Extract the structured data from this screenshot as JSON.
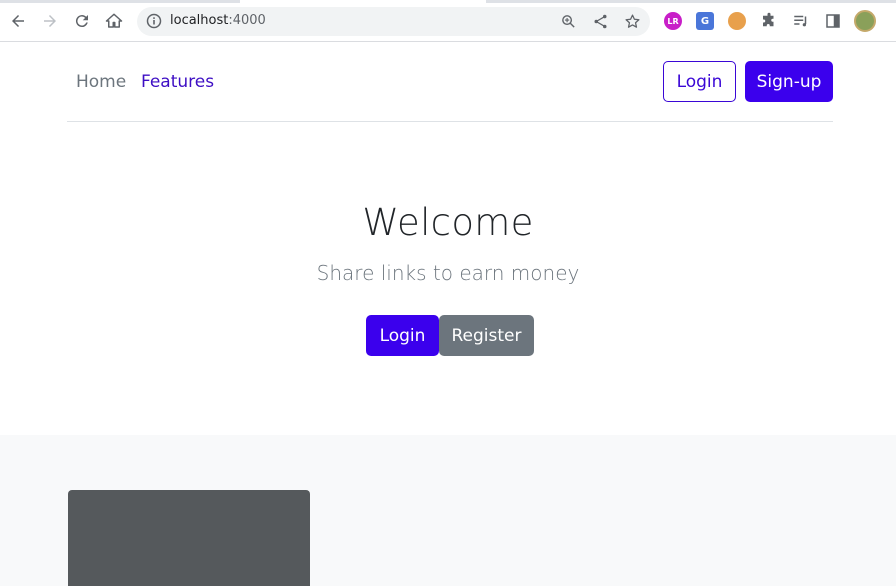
{
  "browser": {
    "url_host": "localhost",
    "url_port": ":4000",
    "icons": [
      "back-icon",
      "forward-icon",
      "reload-icon",
      "home-icon",
      "site-info-icon",
      "zoom-icon",
      "share-icon",
      "bookmark-star-icon",
      "extension-lr-icon",
      "translate-icon",
      "cookie-icon",
      "puzzle-extensions-icon",
      "reading-list-icon",
      "side-panel-icon",
      "profile-avatar"
    ],
    "ext_lr_text": "LR",
    "ext_translate_text": "G"
  },
  "navbar": {
    "home": "Home",
    "features": "Features",
    "login": "Login",
    "signup": "Sign-up"
  },
  "hero": {
    "title": "Welcome",
    "subtitle": "Share links to earn money",
    "login": "Login",
    "register": "Register"
  },
  "colors": {
    "primary": "#3b00ed",
    "secondary": "#6c757d",
    "light_bg": "#f8f9fa",
    "card_img": "#55595c"
  }
}
